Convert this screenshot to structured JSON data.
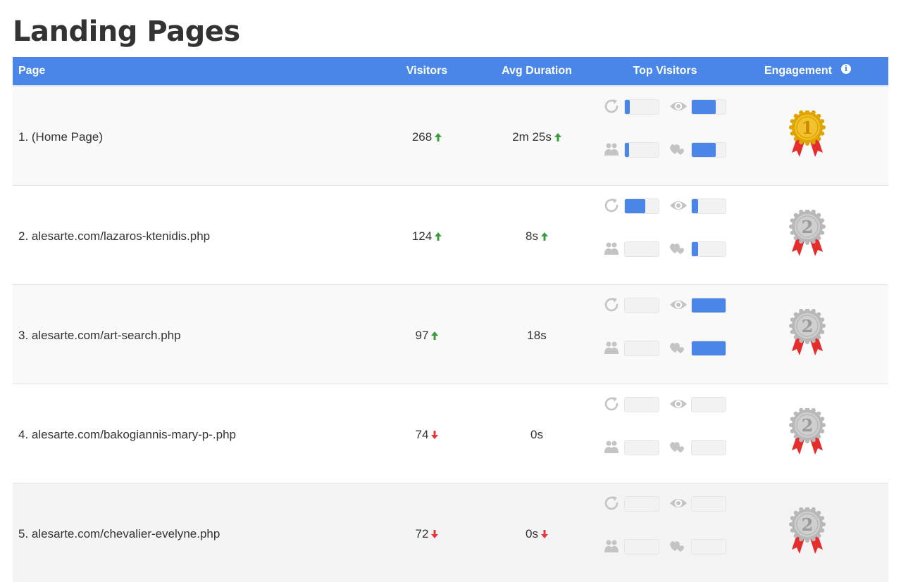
{
  "title": "Landing Pages",
  "columns": {
    "page": "Page",
    "visitors": "Visitors",
    "avg_duration": "Avg Duration",
    "top_visitors": "Top Visitors",
    "engagement": "Engagement"
  },
  "info_icon": "info-icon",
  "colors": {
    "header": "#4a86e8",
    "bar_fill": "#4a86e8",
    "trend_up": "#3c9c3c",
    "trend_down": "#e03a3a",
    "medal_gold": "#f2c12e",
    "medal_silver": "#cfcfcf",
    "ribbon": "#e52d2d"
  },
  "top_visitor_icons": [
    "refresh-icon",
    "eye-icon",
    "people-icon",
    "heart-icon"
  ],
  "rows": [
    {
      "page": "1. (Home Page)",
      "visitors": "268",
      "visitors_trend": "up",
      "duration": "2m 25s",
      "duration_trend": "up",
      "bars": {
        "returning": 0.14,
        "views": 0.7,
        "people": 0.12,
        "loyal": 0.7
      },
      "medal": "1",
      "medal_type": "gold"
    },
    {
      "page": "2. alesarte.com/lazaros-ktenidis.php",
      "visitors": "124",
      "visitors_trend": "up",
      "duration": "8s",
      "duration_trend": "up",
      "bars": {
        "returning": 0.6,
        "views": 0.18,
        "people": 0.0,
        "loyal": 0.18
      },
      "medal": "2",
      "medal_type": "silver"
    },
    {
      "page": "3. alesarte.com/art-search.php",
      "visitors": "97",
      "visitors_trend": "up",
      "duration": "18s",
      "duration_trend": "none",
      "bars": {
        "returning": 0.0,
        "views": 1.0,
        "people": 0.0,
        "loyal": 1.0
      },
      "medal": "2",
      "medal_type": "silver"
    },
    {
      "page": "4. alesarte.com/bakogiannis-mary-p-.php",
      "visitors": "74",
      "visitors_trend": "down",
      "duration": "0s",
      "duration_trend": "none",
      "bars": {
        "returning": 0.0,
        "views": 0.0,
        "people": 0.0,
        "loyal": 0.0
      },
      "medal": "2",
      "medal_type": "silver"
    },
    {
      "page": "5. alesarte.com/chevalier-evelyne.php",
      "visitors": "72",
      "visitors_trend": "down",
      "duration": "0s",
      "duration_trend": "down",
      "bars": {
        "returning": 0.0,
        "views": 0.0,
        "people": 0.0,
        "loyal": 0.0
      },
      "medal": "2",
      "medal_type": "silver"
    }
  ]
}
